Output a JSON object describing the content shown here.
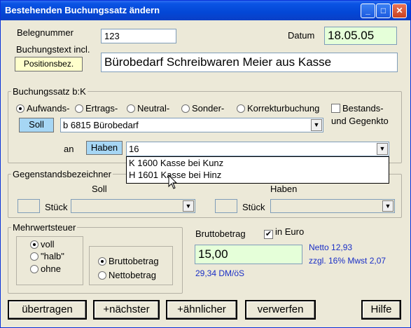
{
  "window": {
    "title": "Bestehenden Buchungssatz ändern"
  },
  "header": {
    "belegnummer_label": "Belegnummer",
    "belegnummer_value": "123",
    "datum_label": "Datum",
    "datum_value": "18.05.05",
    "buchungstext_label": "Buchungstext incl.",
    "positionsbez_button": "Positionsbez.",
    "buchungstext_value": "Bürobedarf Schreibwaren Meier aus Kasse"
  },
  "buchungssatz": {
    "legend": "Buchungssatz b:K",
    "types": [
      {
        "label": "Aufwands-",
        "selected": true
      },
      {
        "label": "Ertrags-",
        "selected": false
      },
      {
        "label": "Neutral-",
        "selected": false
      },
      {
        "label": "Sonder-",
        "selected": false
      },
      {
        "label": "Korrekturbuchung",
        "selected": false
      }
    ],
    "bestands_label_1": "Bestands-",
    "bestands_label_2": "und Gegenkto",
    "soll_button": "Soll",
    "soll_value": "b 6815 Bürobedarf",
    "an_label": "an",
    "haben_button": "Haben",
    "haben_value": "16",
    "haben_options": [
      "K 1600 Kasse bei Kunz",
      "H 1601 Kasse bei Hinz"
    ]
  },
  "gegenstand": {
    "legend": "Gegenstandsbezeichner",
    "soll_label": "Soll",
    "haben_label": "Haben",
    "stueck_label_soll": "Stück",
    "stueck_label_haben": "Stück"
  },
  "mwst": {
    "legend": "Mehrwertsteuer",
    "rates": [
      {
        "label": "voll",
        "selected": true
      },
      {
        "label": "\"halb\"",
        "selected": false
      },
      {
        "label": "ohne",
        "selected": false
      }
    ],
    "amount_types": [
      {
        "label": "Bruttobetrag",
        "selected": true
      },
      {
        "label": "Nettobetrag",
        "selected": false
      }
    ]
  },
  "betrag": {
    "label": "Bruttobetrag",
    "in_euro_label": "in Euro",
    "in_euro_checked": true,
    "value": "15,00",
    "dm_text": "29,34 DM/öS",
    "netto_text": "Netto 12,93",
    "mwst_text": "zzgl. 16% Mwst 2,07"
  },
  "buttons": {
    "uebertragen": "übertragen",
    "naechster": "+nächster",
    "aehnlicher": "+ähnlicher",
    "verwerfen": "verwerfen",
    "hilfe": "Hilfe"
  },
  "colors": {
    "title_bar": "#0a53e4",
    "green_field": "#e5ffd9",
    "yellow_button": "#ffffcc",
    "blue_button": "#a6d6f4",
    "info_text": "#1a2fc6"
  }
}
